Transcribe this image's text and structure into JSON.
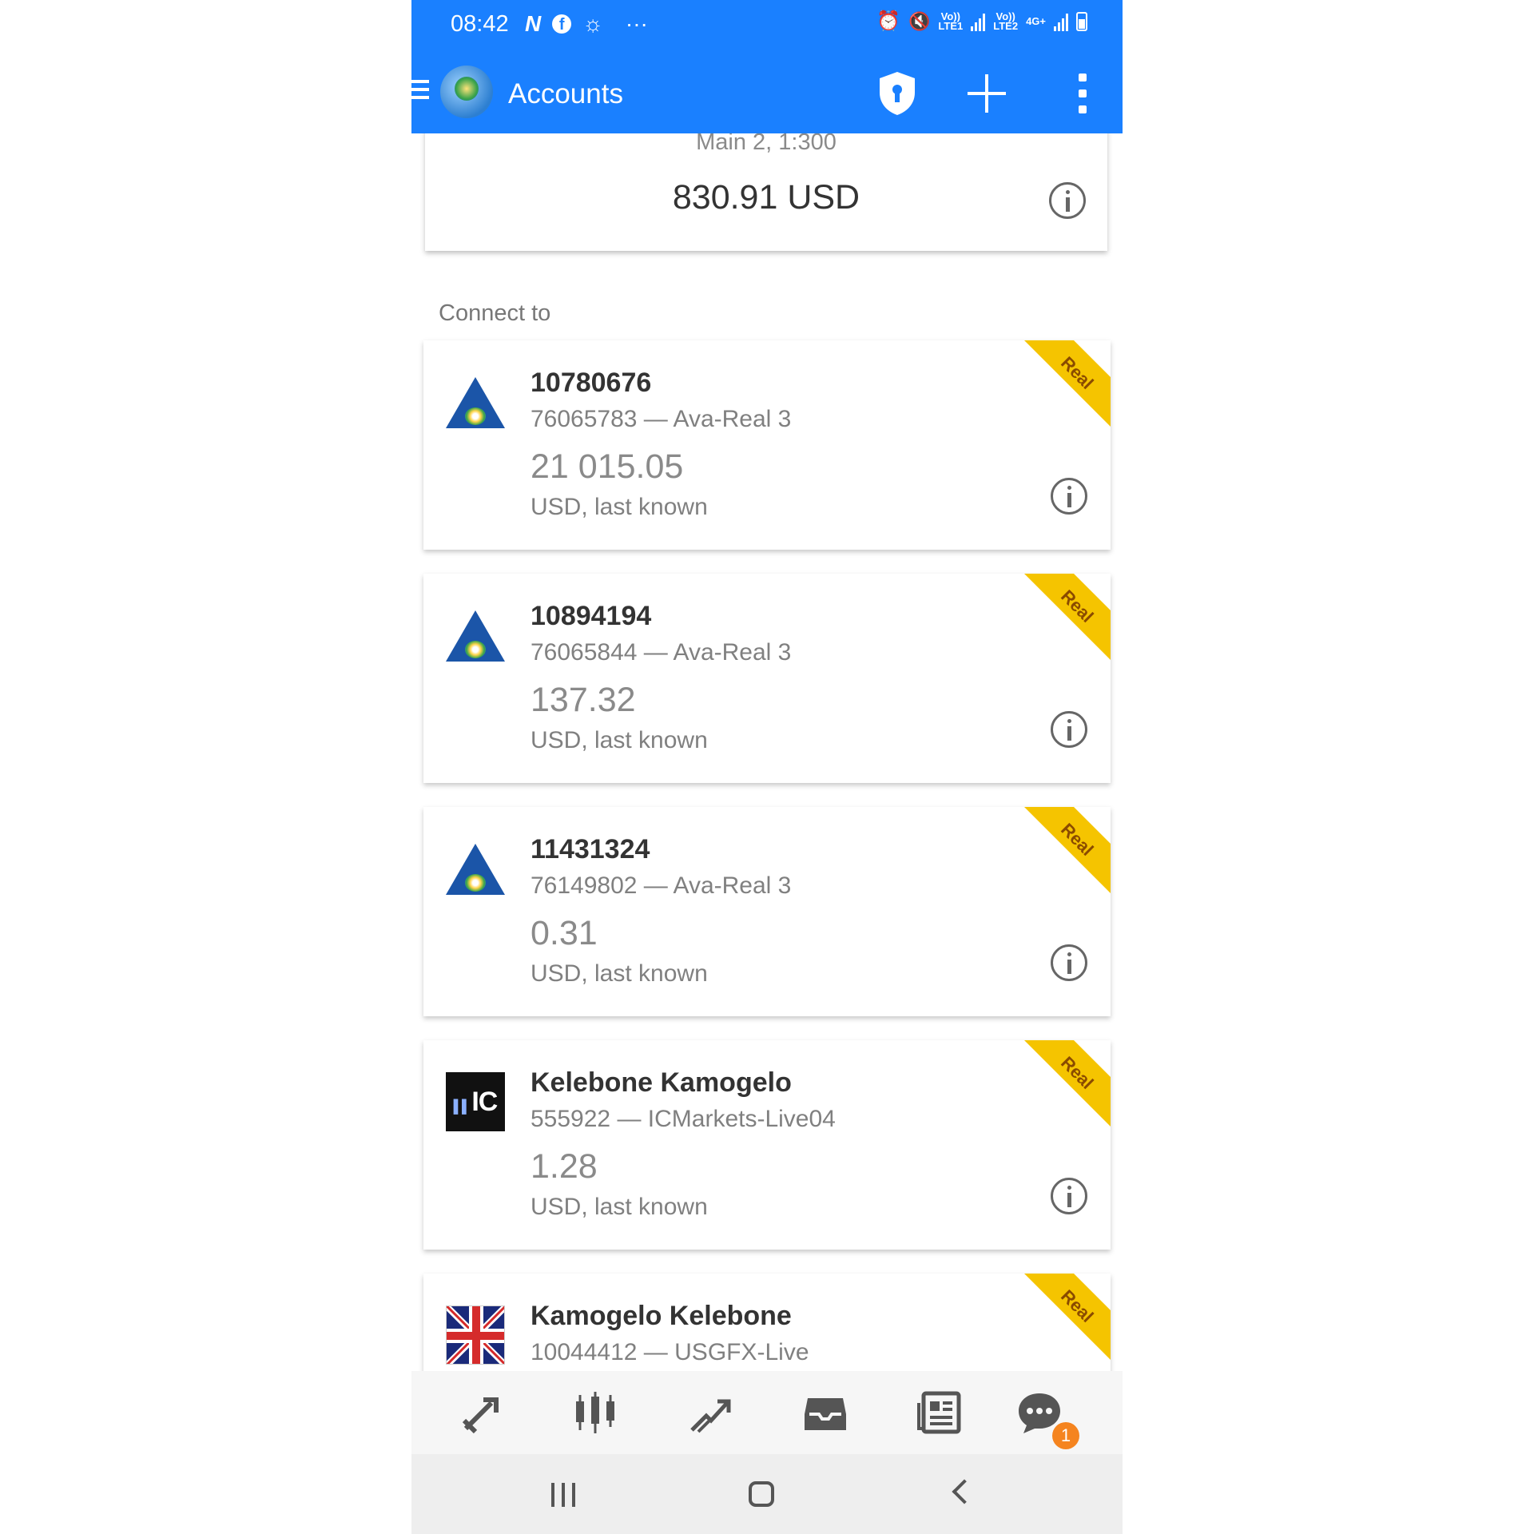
{
  "status_bar": {
    "time": "08:42",
    "left_icons": [
      "n-icon",
      "facebook-icon",
      "globe-icon",
      "more-dots-icon"
    ],
    "lte1": "LTE1",
    "lte2": "LTE2",
    "volte1": "Vo))",
    "volte2": "Vo))",
    "network": "4G+"
  },
  "app_bar": {
    "title": "Accounts",
    "accent": "#1a80ff"
  },
  "current_account": {
    "subtitle": "Main 2, 1:300",
    "balance": "830.91 USD"
  },
  "section_label": "Connect to",
  "accounts": [
    {
      "name": "10780676",
      "server": "76065783 — Ava-Real 3",
      "balance": "21 015.05",
      "currency": "USD, last known",
      "badge": "Real",
      "logo": "ava-logo"
    },
    {
      "name": "10894194",
      "server": "76065844 — Ava-Real 3",
      "balance": "137.32",
      "currency": "USD, last known",
      "badge": "Real",
      "logo": "ava-logo"
    },
    {
      "name": "11431324",
      "server": "76149802 — Ava-Real 3",
      "balance": "0.31",
      "currency": "USD, last known",
      "badge": "Real",
      "logo": "ava-logo"
    },
    {
      "name": "Kelebone Kamogelo",
      "server": "555922 — ICMarkets-Live04",
      "balance": "1.28",
      "currency": "USD, last known",
      "badge": "Real",
      "logo": "icmarkets-logo",
      "logo_text": "IC"
    },
    {
      "name": "Kamogelo Kelebone",
      "server": "10044412 — USGFX-Live",
      "badge": "Real",
      "logo": "uk-flag-logo"
    }
  ],
  "bottom_nav": {
    "items": [
      "quotes-icon",
      "chart-icon",
      "trade-icon",
      "history-icon",
      "news-icon",
      "chat-icon"
    ],
    "chat_badge": "1"
  },
  "system_nav": [
    "recents-button",
    "home-button",
    "back-button"
  ]
}
